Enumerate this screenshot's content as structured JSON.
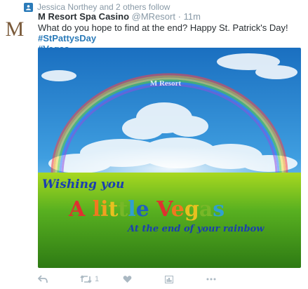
{
  "context": {
    "text": "Jessica Northey and 2 others follow",
    "icon": "follow-badge-icon"
  },
  "tweet": {
    "author_name": "M Resort Spa Casino",
    "handle": "@MResort",
    "separator": "·",
    "time": "11m",
    "text_before": "What do you hope to find at the end? Happy St. Patrick's Day! ",
    "hashtag1": "#StPattysDay",
    "hashtag2": "#Vegas",
    "avatar_logo": "M"
  },
  "image": {
    "watermark": "M Resort",
    "line1": "Wishing you",
    "line2_letters": [
      "A",
      " ",
      "l",
      "i",
      "t",
      "t",
      "l",
      "e",
      " ",
      "V",
      "e",
      "g",
      "a",
      "s"
    ],
    "line2_colors": [
      "#e03030",
      "#000000",
      "#f07820",
      "#f0a020",
      "#e8c020",
      "#78b828",
      "#30a0d0",
      "#2060c0",
      "#000000",
      "#e03030",
      "#f07820",
      "#e8c020",
      "#78b828",
      "#30a0d0"
    ],
    "line3": "At the end of your rainbow"
  },
  "actions": {
    "reply_icon": "reply-icon",
    "retweet_icon": "retweet-icon",
    "retweet_count": "1",
    "like_icon": "heart-icon",
    "analytics_icon": "analytics-icon",
    "more_icon": "more-dots-icon"
  }
}
